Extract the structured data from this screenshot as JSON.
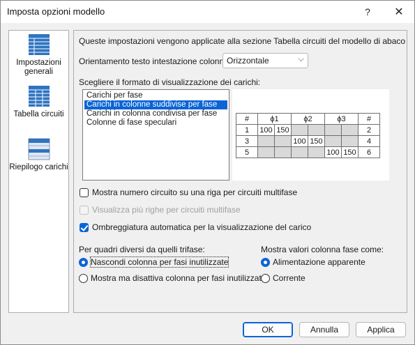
{
  "window": {
    "title": "Imposta opzioni modello",
    "help": "?",
    "close": "✕"
  },
  "sidebar": {
    "items": [
      {
        "label": "Impostazioni generali"
      },
      {
        "label": "Tabella circuiti"
      },
      {
        "label": "Riepilogo carichi"
      }
    ]
  },
  "content": {
    "description": "Queste impostazioni vengono applicate alla sezione Tabella circuiti del modello di abaco quadri elettrici.",
    "orientation_label": "Orientamento testo intestazione colonna:",
    "orientation_value": "Orizzontale",
    "format_label": "Scegliere il formato di visualizzazione dei carichi:",
    "formats": [
      "Carichi per fase",
      "Carichi in colonne suddivise per fase",
      "Carichi in colonna condivisa per fase",
      "Colonne di fase speculari"
    ],
    "selected_format": 1,
    "preview": {
      "headers": [
        "#",
        "ϕ1",
        "ϕ2",
        "ϕ3",
        "#"
      ],
      "rows": [
        {
          "left": "1",
          "cells": [
            "100",
            "150",
            "",
            "",
            "",
            ""
          ],
          "right": "2"
        },
        {
          "left": "3",
          "cells": [
            "",
            "",
            "100",
            "150",
            "",
            ""
          ],
          "right": "4"
        },
        {
          "left": "5",
          "cells": [
            "",
            "",
            "",
            "",
            "100",
            "150"
          ],
          "right": "6"
        }
      ]
    },
    "checkboxes": [
      {
        "label": "Mostra numero circuito su una riga per circuiti multifase",
        "checked": false,
        "enabled": true
      },
      {
        "label": "Visualizza più righe per circuiti multifase",
        "checked": false,
        "enabled": false
      },
      {
        "label": "Ombreggiatura automatica per la visualizzazione del carico",
        "checked": true,
        "enabled": true
      }
    ],
    "group1": {
      "title": "Per quadri diversi da quelli trifase:",
      "options": [
        {
          "label": "Nascondi colonna per fasi inutilizzate",
          "selected": true
        },
        {
          "label": "Mostra ma disattiva colonna per fasi inutilizzate",
          "selected": false
        }
      ]
    },
    "group2": {
      "title": "Mostra valori colonna fase come:",
      "options": [
        {
          "label": "Alimentazione apparente",
          "selected": true
        },
        {
          "label": "Corrente",
          "selected": false
        }
      ]
    }
  },
  "buttons": {
    "ok": "OK",
    "cancel": "Annulla",
    "apply": "Applica"
  },
  "colors": {
    "accent": "#0a64d6",
    "shade": "#d9d9d9",
    "icon_blue": "#2f74c0"
  }
}
